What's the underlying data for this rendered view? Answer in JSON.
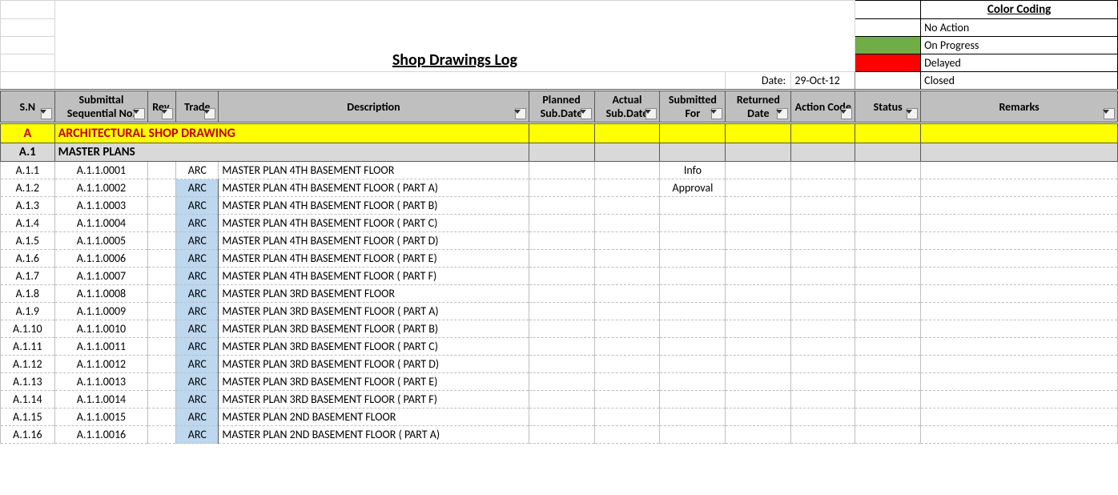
{
  "title": "Shop Drawings Log",
  "date_label": "Date:",
  "date_value": "29-Oct-12",
  "legend": {
    "title": "Color Coding",
    "items": [
      "No Action",
      "On Progress",
      "Delayed",
      "Closed"
    ]
  },
  "headers": {
    "sn": "S.N",
    "seq": "Submittal Sequential No.",
    "rev": "Rev.",
    "trade": "Trade",
    "desc": "Description",
    "planned": "Planned Sub.Date",
    "actual": "Actual Sub.Date",
    "subfor": "Submitted For",
    "returned": "Returned Date",
    "action": "Action Code",
    "status": "Status",
    "remarks": "Remarks"
  },
  "section": {
    "code": "A",
    "title": "ARCHITECTURAL SHOP DRAWING"
  },
  "subsection": {
    "code": "A.1",
    "title": "MASTER PLANS"
  },
  "rows": [
    {
      "sn": "A.1.1",
      "seq": "A.1.1.0001",
      "trade": "ARC",
      "trade_hl": false,
      "desc": "MASTER PLAN  4TH BASEMENT FLOOR",
      "subfor": "Info"
    },
    {
      "sn": "A.1.2",
      "seq": "A.1.1.0002",
      "trade": "ARC",
      "trade_hl": true,
      "desc": "MASTER PLAN  4TH BASEMENT FLOOR ( PART A)",
      "subfor": "Approval"
    },
    {
      "sn": "A.1.3",
      "seq": "A.1.1.0003",
      "trade": "ARC",
      "trade_hl": true,
      "desc": "MASTER PLAN  4TH BASEMENT FLOOR ( PART B)",
      "subfor": ""
    },
    {
      "sn": "A.1.4",
      "seq": "A.1.1.0004",
      "trade": "ARC",
      "trade_hl": true,
      "desc": "MASTER PLAN  4TH BASEMENT FLOOR ( PART C)",
      "subfor": ""
    },
    {
      "sn": "A.1.5",
      "seq": "A.1.1.0005",
      "trade": "ARC",
      "trade_hl": true,
      "desc": "MASTER PLAN  4TH BASEMENT FLOOR ( PART D)",
      "subfor": ""
    },
    {
      "sn": "A.1.6",
      "seq": "A.1.1.0006",
      "trade": "ARC",
      "trade_hl": true,
      "desc": "MASTER PLAN  4TH BASEMENT FLOOR ( PART E)",
      "subfor": ""
    },
    {
      "sn": "A.1.7",
      "seq": "A.1.1.0007",
      "trade": "ARC",
      "trade_hl": true,
      "desc": "MASTER PLAN  4TH BASEMENT FLOOR ( PART F)",
      "subfor": ""
    },
    {
      "sn": "A.1.8",
      "seq": "A.1.1.0008",
      "trade": "ARC",
      "trade_hl": true,
      "desc": "MASTER PLAN  3RD BASEMENT FLOOR",
      "subfor": ""
    },
    {
      "sn": "A.1.9",
      "seq": "A.1.1.0009",
      "trade": "ARC",
      "trade_hl": true,
      "desc": "MASTER PLAN  3RD BASEMENT FLOOR ( PART A)",
      "subfor": ""
    },
    {
      "sn": "A.1.10",
      "seq": "A.1.1.0010",
      "trade": "ARC",
      "trade_hl": true,
      "desc": "MASTER PLAN  3RD BASEMENT FLOOR ( PART B)",
      "subfor": ""
    },
    {
      "sn": "A.1.11",
      "seq": "A.1.1.0011",
      "trade": "ARC",
      "trade_hl": true,
      "desc": "MASTER PLAN  3RD BASEMENT FLOOR ( PART C)",
      "subfor": ""
    },
    {
      "sn": "A.1.12",
      "seq": "A.1.1.0012",
      "trade": "ARC",
      "trade_hl": true,
      "desc": "MASTER PLAN  3RD BASEMENT FLOOR ( PART D)",
      "subfor": ""
    },
    {
      "sn": "A.1.13",
      "seq": "A.1.1.0013",
      "trade": "ARC",
      "trade_hl": true,
      "desc": "MASTER PLAN  3RD BASEMENT FLOOR ( PART E)",
      "subfor": ""
    },
    {
      "sn": "A.1.14",
      "seq": "A.1.1.0014",
      "trade": "ARC",
      "trade_hl": true,
      "desc": "MASTER PLAN  3RD BASEMENT FLOOR ( PART F)",
      "subfor": ""
    },
    {
      "sn": "A.1.15",
      "seq": "A.1.1.0015",
      "trade": "ARC",
      "trade_hl": true,
      "desc": "MASTER PLAN  2ND BASEMENT FLOOR",
      "subfor": ""
    },
    {
      "sn": "A.1.16",
      "seq": "A.1.1.0016",
      "trade": "ARC",
      "trade_hl": true,
      "desc": "MASTER PLAN  2ND BASEMENT FLOOR ( PART A)",
      "subfor": ""
    }
  ]
}
